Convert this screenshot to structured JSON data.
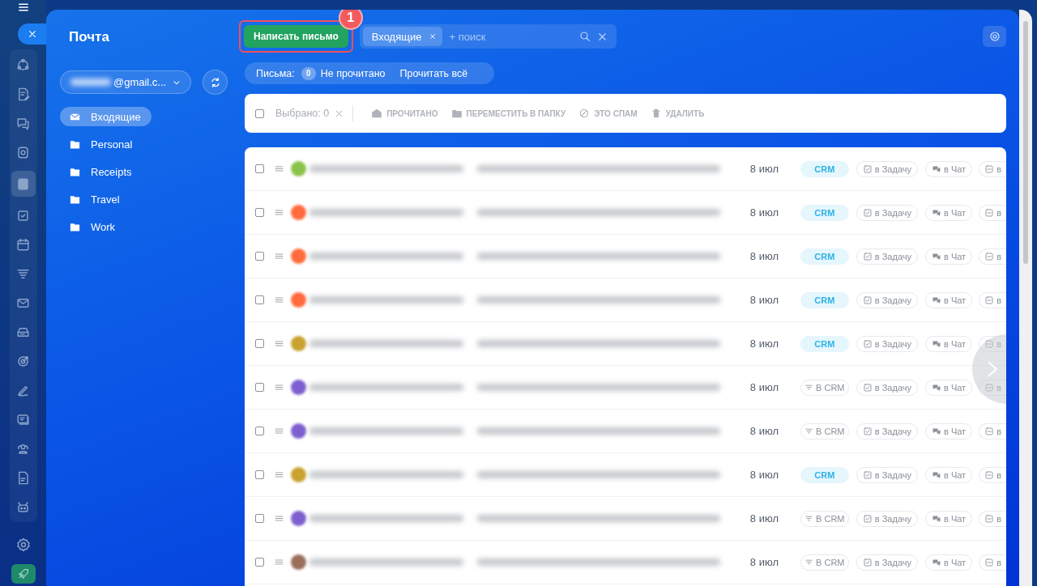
{
  "sidebar": {
    "title": "Почта",
    "account": {
      "value": "@gmail.c..."
    },
    "folders": [
      {
        "kind": "inbox",
        "label": "Входящие",
        "selected": true
      },
      {
        "kind": "folder",
        "label": "Personal",
        "selected": false
      },
      {
        "kind": "folder",
        "label": "Receipts",
        "selected": false
      },
      {
        "kind": "folder",
        "label": "Travel",
        "selected": false
      },
      {
        "kind": "folder",
        "label": "Work",
        "selected": false
      }
    ]
  },
  "compose_button": {
    "label": "Написать письмо",
    "callout": "1"
  },
  "search": {
    "chip": "Входящие",
    "placeholder": "+ поиск"
  },
  "counters": {
    "label": "Письма:",
    "count": "0",
    "unread": "Не прочитано",
    "read_all": "Прочитать всё"
  },
  "toolbar": {
    "checked": false,
    "selected": "Выбрано: 0",
    "actions": [
      {
        "kind": "read",
        "label": "ПРОЧИТАНО",
        "disabled": true
      },
      {
        "kind": "move",
        "label": "ПЕРЕМЕСТИТЬ В ПАПКУ",
        "disabled": true
      },
      {
        "kind": "spam",
        "label": "ЭТО СПАМ",
        "disabled": true
      },
      {
        "kind": "delete",
        "label": "УДАЛИТЬ",
        "disabled": true
      }
    ]
  },
  "rows": [
    {
      "checked": false,
      "color": "#8bc34a",
      "date": "8 июл",
      "crm": {
        "kind": "badge",
        "label": "CRM"
      },
      "task": "в Задачу",
      "chat": "в Чат",
      "more": "в"
    },
    {
      "checked": false,
      "color": "#ff6b3d",
      "date": "8 июл",
      "crm": {
        "kind": "badge",
        "label": "CRM"
      },
      "task": "в Задачу",
      "chat": "в Чат",
      "more": "в"
    },
    {
      "checked": false,
      "color": "#ff6b3d",
      "date": "8 июл",
      "crm": {
        "kind": "badge",
        "label": "CRM"
      },
      "task": "в Задачу",
      "chat": "в Чат",
      "more": "в"
    },
    {
      "checked": false,
      "color": "#ff6b3d",
      "date": "8 июл",
      "crm": {
        "kind": "badge",
        "label": "CRM"
      },
      "task": "в Задачу",
      "chat": "в Чат",
      "more": "в"
    },
    {
      "checked": false,
      "color": "#c9a230",
      "date": "8 июл",
      "crm": {
        "kind": "badge",
        "label": "CRM"
      },
      "task": "в Задачу",
      "chat": "в Чат",
      "more": "в"
    },
    {
      "checked": false,
      "color": "#7e5fd0",
      "date": "8 июл",
      "crm": {
        "kind": "button",
        "label": "В CRM"
      },
      "task": "в Задачу",
      "chat": "в Чат",
      "more": "в"
    },
    {
      "checked": false,
      "color": "#7e5fd0",
      "date": "8 июл",
      "crm": {
        "kind": "button",
        "label": "В CRM"
      },
      "task": "в Задачу",
      "chat": "в Чат",
      "more": "в"
    },
    {
      "checked": false,
      "color": "#c9a230",
      "date": "8 июл",
      "crm": {
        "kind": "badge",
        "label": "CRM"
      },
      "task": "в Задачу",
      "chat": "в Чат",
      "more": "в"
    },
    {
      "checked": false,
      "color": "#7e5fd0",
      "date": "8 июл",
      "crm": {
        "kind": "button",
        "label": "В CRM"
      },
      "task": "в Задачу",
      "chat": "в Чат",
      "more": "в"
    },
    {
      "checked": false,
      "color": "#9a6f5c",
      "date": "8 июл",
      "crm": {
        "kind": "button",
        "label": "В CRM"
      },
      "task": "в Задачу",
      "chat": "в Чат",
      "more": "в"
    }
  ]
}
